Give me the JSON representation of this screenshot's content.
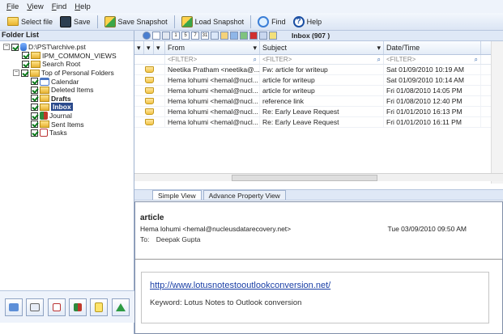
{
  "menu": [
    "File",
    "View",
    "Find",
    "Help"
  ],
  "toolbar": {
    "select_file": "Select file",
    "save": "Save",
    "save_snapshot": "Save Snapshot",
    "load_snapshot": "Load Snapshot",
    "find": "Find",
    "help": "Help"
  },
  "folder_list": {
    "title": "Folder List",
    "items": [
      {
        "label": "D:\\PST\\archive.pst",
        "level": 0
      },
      {
        "label": "IPM_COMMON_VIEWS",
        "level": 1
      },
      {
        "label": "Search Root",
        "level": 1
      },
      {
        "label": "Top of Personal Folders",
        "level": 1
      },
      {
        "label": "Calendar",
        "level": 2
      },
      {
        "label": "Deleted Items",
        "level": 2
      },
      {
        "label": "Drafts",
        "level": 2
      },
      {
        "label": "Inbox",
        "level": 2
      },
      {
        "label": "Journal",
        "level": 2
      },
      {
        "label": "Sent Items",
        "level": 2
      },
      {
        "label": "Tasks",
        "level": 2
      }
    ]
  },
  "right_toolbar": {
    "inbox_count": "Inbox (907 )"
  },
  "grid": {
    "columns": [
      "From",
      "Subject",
      "Date/Time"
    ],
    "filter_placeholder": "<FILTER>",
    "rows": [
      {
        "from": "Neetika Pratham <neetika@...",
        "subject": "Fw: article for writeup",
        "date": "Sat 01/09/2010 10:19 AM"
      },
      {
        "from": "Hema lohumi <hemal@nucl...",
        "subject": "article for writeup",
        "date": "Sat 01/09/2010 10:14 AM"
      },
      {
        "from": "Hema lohumi <hemal@nucl...",
        "subject": "article for writeup",
        "date": "Fri 01/08/2010 14:05 PM"
      },
      {
        "from": "Hema lohumi <hemal@nucl...",
        "subject": "reference link",
        "date": "Fri 01/08/2010 12:40 PM"
      },
      {
        "from": "Hema lohumi <hemal@nucl...",
        "subject": "Re: Early Leave Request",
        "date": "Fri 01/01/2010 16:13 PM"
      },
      {
        "from": "Hema lohumi <hemal@nucl...",
        "subject": "Re: Early Leave Request",
        "date": "Fri 01/01/2010 16:11 PM"
      }
    ]
  },
  "tabs": [
    "Simple View",
    "Advance Property View"
  ],
  "preview": {
    "subject": "article",
    "from": "Hema lohumi <hemal@nucleusdatarecovery.net>",
    "date": "Tue 03/09/2010 09:50 AM",
    "to_label": "To:",
    "to": "Deepak Gupta",
    "link": "http://www.lotusnotestooutlookconversion.net/",
    "keyword": "Keyword: Lotus Notes to Outlook conversion"
  }
}
